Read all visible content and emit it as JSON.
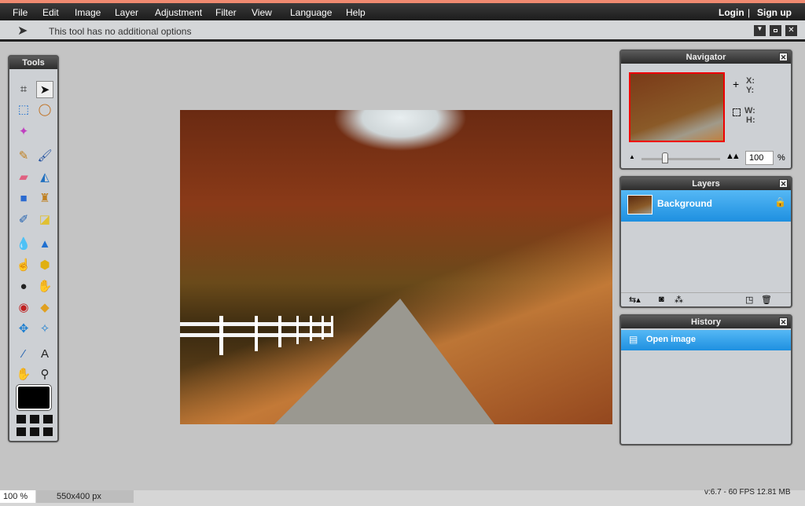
{
  "menu": {
    "items": [
      "File",
      "Edit",
      "Image",
      "Layer",
      "Adjustment",
      "Filter",
      "View",
      "Language",
      "Help"
    ],
    "login": "Login",
    "separator": "|",
    "signup": "Sign up"
  },
  "options": {
    "tool_icon": "move-icon",
    "text": "This tool has no additional options"
  },
  "tools": {
    "title": "Tools",
    "items": [
      "crop",
      "move",
      "marquee",
      "lasso",
      "wand",
      "pencil",
      "brush",
      "eraser",
      "paint-bucket",
      "gradient",
      "clone-stamp",
      "color-replace",
      "drawing",
      "blur",
      "sharpen",
      "smudge",
      "sponge",
      "dodge",
      "burn",
      "red-eye",
      "spot-heal",
      "bloat",
      "pinch",
      "color-picker",
      "type",
      "hand",
      "zoom"
    ],
    "foreground_color": "#000000"
  },
  "navigator": {
    "title": "Navigator",
    "x_label": "X:",
    "y_label": "Y:",
    "w_label": "W:",
    "h_label": "H:",
    "zoom_value": "100",
    "zoom_unit": "%",
    "slider_percent": 30
  },
  "layers": {
    "title": "Layers",
    "items": [
      {
        "name": "Background",
        "locked": true
      }
    ]
  },
  "history": {
    "title": "History",
    "items": [
      "Open image"
    ]
  },
  "status": {
    "zoom": "100 %",
    "size": "550x400 px",
    "info": "v:6.7 - 60 FPS 12.81 MB"
  },
  "colors": {
    "selection": "#2e9de6",
    "menu": "#1c1c1c"
  }
}
